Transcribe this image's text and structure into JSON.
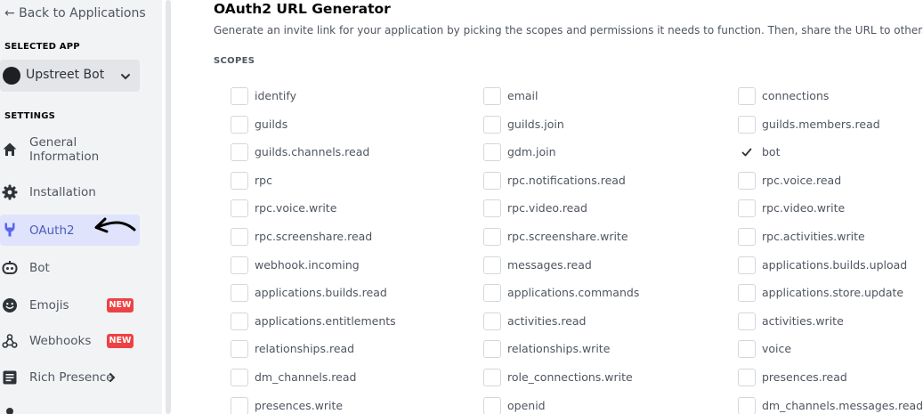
{
  "sidebar": {
    "back_label": "← Back to Applications",
    "selected_app_label": "SELECTED APP",
    "app_name": "Upstreet Bot",
    "settings_label": "SETTINGS",
    "items": [
      {
        "label": "General Information",
        "line1": "General",
        "line2": "Information",
        "icon": "home-icon"
      },
      {
        "label": "Installation",
        "icon": "gear-icon"
      },
      {
        "label": "OAuth2",
        "icon": "wrench-icon",
        "active": true
      },
      {
        "label": "Bot",
        "icon": "bot-icon"
      },
      {
        "label": "Emojis",
        "icon": "smiley-icon",
        "badge": "NEW"
      },
      {
        "label": "Webhooks",
        "icon": "webhook-icon",
        "badge": "NEW"
      },
      {
        "label": "Rich Presence",
        "icon": "document-icon",
        "has_chevron": true
      }
    ]
  },
  "main": {
    "title": "OAuth2 URL Generator",
    "description": "Generate an invite link for your application by picking the scopes and permissions it needs to function. Then, share the URL to others!",
    "scopes_label": "SCOPES",
    "scopes": [
      [
        {
          "name": "identify",
          "checked": false
        },
        {
          "name": "email",
          "checked": false
        },
        {
          "name": "connections",
          "checked": false
        }
      ],
      [
        {
          "name": "guilds",
          "checked": false
        },
        {
          "name": "guilds.join",
          "checked": false
        },
        {
          "name": "guilds.members.read",
          "checked": false
        }
      ],
      [
        {
          "name": "guilds.channels.read",
          "checked": false
        },
        {
          "name": "gdm.join",
          "checked": false
        },
        {
          "name": "bot",
          "checked": true
        }
      ],
      [
        {
          "name": "rpc",
          "checked": false
        },
        {
          "name": "rpc.notifications.read",
          "checked": false
        },
        {
          "name": "rpc.voice.read",
          "checked": false
        }
      ],
      [
        {
          "name": "rpc.voice.write",
          "checked": false
        },
        {
          "name": "rpc.video.read",
          "checked": false
        },
        {
          "name": "rpc.video.write",
          "checked": false
        }
      ],
      [
        {
          "name": "rpc.screenshare.read",
          "checked": false
        },
        {
          "name": "rpc.screenshare.write",
          "checked": false
        },
        {
          "name": "rpc.activities.write",
          "checked": false
        }
      ],
      [
        {
          "name": "webhook.incoming",
          "checked": false
        },
        {
          "name": "messages.read",
          "checked": false
        },
        {
          "name": "applications.builds.upload",
          "checked": false
        }
      ],
      [
        {
          "name": "applications.builds.read",
          "checked": false
        },
        {
          "name": "applications.commands",
          "checked": false
        },
        {
          "name": "applications.store.update",
          "checked": false
        }
      ],
      [
        {
          "name": "applications.entitlements",
          "checked": false
        },
        {
          "name": "activities.read",
          "checked": false
        },
        {
          "name": "activities.write",
          "checked": false
        }
      ],
      [
        {
          "name": "relationships.read",
          "checked": false
        },
        {
          "name": "relationships.write",
          "checked": false
        },
        {
          "name": "voice",
          "checked": false
        }
      ],
      [
        {
          "name": "dm_channels.read",
          "checked": false
        },
        {
          "name": "role_connections.write",
          "checked": false
        },
        {
          "name": "presences.read",
          "checked": false
        }
      ],
      [
        {
          "name": "presences.write",
          "checked": false
        },
        {
          "name": "openid",
          "checked": false
        },
        {
          "name": "dm_channels.messages.read",
          "checked": false
        }
      ]
    ]
  },
  "colors": {
    "accent": "#5865f2",
    "active_bg": "#dfe3fb",
    "badge": "#ed4245",
    "sidebar_bg": "#f2f3f5"
  }
}
